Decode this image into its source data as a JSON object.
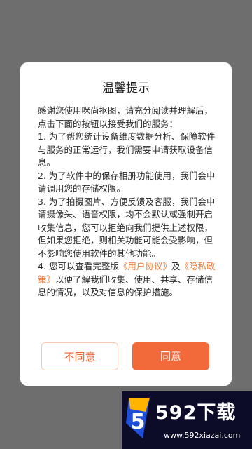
{
  "dialog": {
    "title": "温馨提示",
    "intro": "感谢您使用咪尚抠图，请充分阅读并理解后，点击下面的按钮以接受我们的服务：",
    "item1": "1. 为了帮您统计设备维度数据分析、保障软件与服务的正常运行，我们需要申请获取设备信息。",
    "item2": "2. 为了软件中的保存相册功能使用，我们会申请调用您的存储权限。",
    "item3": "3. 为了拍摄图片、方便反馈及客服，我们会申请摄像头、语音权限，均不会默认或强制开启收集信息，您可以拒绝向我们提供上述权限，但如果您拒绝，则相关功能可能会受影响，但不影响您使用软件的其他功能。",
    "item4_prefix": "4. 您可以查看完整版",
    "user_agreement_link": "《用户协议》",
    "item4_and": "及",
    "privacy_policy_link": "《隐私政策》",
    "item4_suffix": "以便了解我们收集、使用、共享、存储信息的情况，以及对信息的保护措施。",
    "reject_label": "不同意",
    "agree_label": "同意"
  },
  "watermark": {
    "brand": "592下载",
    "logo_char": "5",
    "url": "www.592xiazai.com"
  },
  "colors": {
    "accent": "#f36a3a",
    "overlay": "#6e6e6e",
    "watermark_bg": "#0c0c28"
  }
}
